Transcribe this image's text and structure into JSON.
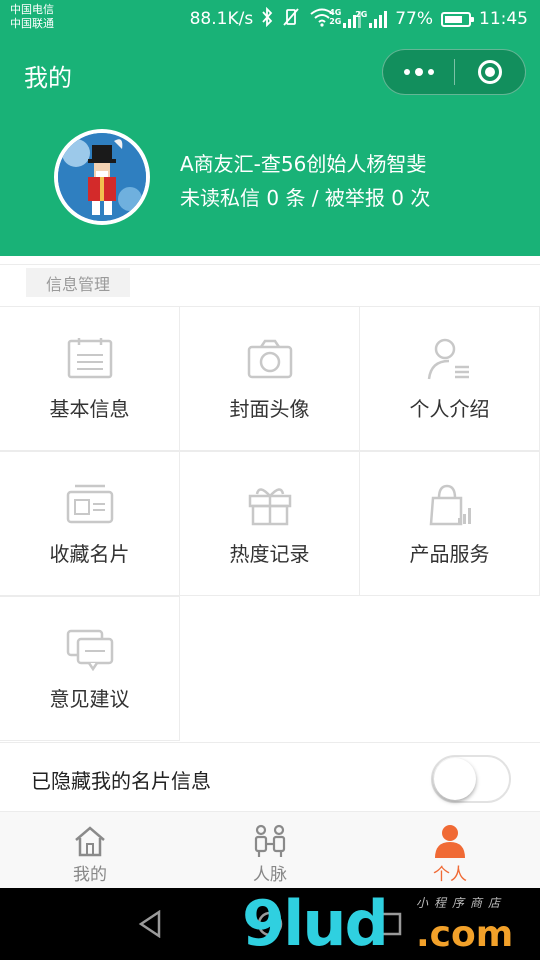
{
  "status_bar": {
    "carrier_1": "中国电信",
    "carrier_2": "中国联通",
    "net_speed": "88.1K/s",
    "sim1_type": "4G",
    "sim2_type": "2G",
    "battery": "77%",
    "battery_level": 0.77,
    "time": "11:45",
    "icons": [
      "bluetooth-icon",
      "vibrate-off-icon",
      "wifi-icon",
      "signal-icon",
      "battery-icon"
    ]
  },
  "header": {
    "title": "我的",
    "bg_color": "#19b277",
    "capsule_icons": [
      "more-dots-icon",
      "close-target-icon"
    ]
  },
  "profile": {
    "name": "A商友汇-查56创始人杨智斐",
    "stats": "未读私信 0 条 / 被举报 0 次"
  },
  "section": {
    "label": "信息管理"
  },
  "grid": [
    {
      "label": "基本信息",
      "icon": "document-icon"
    },
    {
      "label": "封面头像",
      "icon": "camera-icon"
    },
    {
      "label": "个人介绍",
      "icon": "person-card-icon"
    },
    {
      "label": "收藏名片",
      "icon": "wallet-card-icon"
    },
    {
      "label": "热度记录",
      "icon": "gift-box-icon"
    },
    {
      "label": "产品服务",
      "icon": "shopping-bag-chart-icon"
    },
    {
      "label": "意见建议",
      "icon": "feedback-chat-icon"
    }
  ],
  "hide_setting": {
    "label": "已隐藏我的名片信息",
    "enabled": false
  },
  "tabs": [
    {
      "label": "我的",
      "icon": "home-icon",
      "active": false
    },
    {
      "label": "人脉",
      "icon": "contacts-icon",
      "active": false
    },
    {
      "label": "个人",
      "icon": "person-icon",
      "active": true
    }
  ],
  "accent_active": "#f06a35",
  "watermark": {
    "main": "9lud",
    "suffix": ".com",
    "tagline": "小程序商店"
  }
}
